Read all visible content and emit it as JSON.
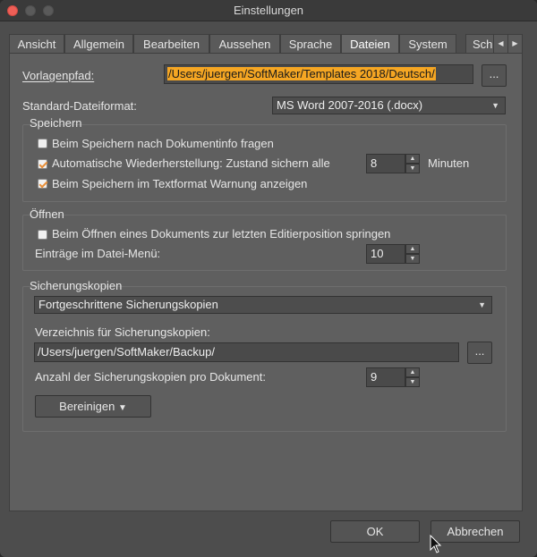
{
  "window": {
    "title": "Einstellungen"
  },
  "tabs": [
    {
      "label": "Ansicht"
    },
    {
      "label": "Allgemein"
    },
    {
      "label": "Bearbeiten"
    },
    {
      "label": "Aussehen"
    },
    {
      "label": "Sprache"
    },
    {
      "label": "Dateien",
      "active": true
    },
    {
      "label": "System"
    },
    {
      "label": "Schri"
    }
  ],
  "tab_scroll": {
    "left": "◀",
    "right": "▶"
  },
  "template_path": {
    "label": "Vorlagenpfad:",
    "value": "/Users/juergen/SoftMaker/Templates 2018/Deutsch/",
    "browse": "..."
  },
  "default_format": {
    "label": "Standard-Dateiformat:",
    "value": "MS Word 2007-2016 (.docx)"
  },
  "save_group": {
    "title": "Speichern",
    "ask_docinfo": {
      "label": "Beim Speichern nach Dokumentinfo fragen",
      "checked": false
    },
    "autorecover": {
      "label": "Automatische Wiederherstellung: Zustand sichern alle",
      "checked": true,
      "value": "8",
      "unit": "Minuten"
    },
    "warn_text": {
      "label": "Beim Speichern im Textformat Warnung anzeigen",
      "checked": true
    }
  },
  "open_group": {
    "title": "Öffnen",
    "jump_last": {
      "label": "Beim Öffnen eines Dokuments zur letzten Editierposition springen",
      "checked": false
    },
    "menu_entries": {
      "label": "Einträge im Datei-Menü:",
      "value": "10"
    }
  },
  "backup_group": {
    "title": "Sicherungskopien",
    "mode": "Fortgeschrittene Sicherungskopien",
    "dir_label": "Verzeichnis für Sicherungskopien:",
    "dir_value": "/Users/juergen/SoftMaker/Backup/",
    "browse": "...",
    "count_label": "Anzahl der Sicherungskopien pro Dokument:",
    "count_value": "9",
    "cleanup": "Bereinigen"
  },
  "footer": {
    "ok": "OK",
    "cancel": "Abbrechen"
  },
  "colors": {
    "highlight": "#f5a623",
    "check": "#e8903a",
    "panel": "#5f5f5f",
    "window": "#4d4d4d"
  }
}
